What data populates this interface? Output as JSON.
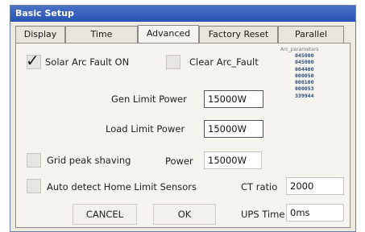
{
  "window": {
    "title": "Basic Setup"
  },
  "tabs": [
    "Display",
    "Time",
    "Advanced",
    "Factory Reset",
    "Parallel"
  ],
  "solar_arc_fault": {
    "label": "Solar Arc Fault ON",
    "checked": true
  },
  "clear_arc_fault": {
    "label": "Clear Arc_Fault"
  },
  "arc_log": {
    "header": "Arc_parameters",
    "values": [
      "045000",
      "045000",
      "004400",
      "000050",
      "000100",
      "000053",
      "339944"
    ]
  },
  "gen_limit_power": {
    "label": "Gen Limit Power",
    "value": "15000W"
  },
  "load_limit_power": {
    "label": "Load Limit Power",
    "value": "15000W"
  },
  "grid_peak_shaving": {
    "label": "Grid peak shaving",
    "power_label": "Power",
    "power_value": "15000W",
    "checked": false
  },
  "auto_detect": {
    "label": "Auto detect Home Limit Sensors",
    "checked": false
  },
  "ct_ratio": {
    "label": "CT ratio",
    "value": "2000"
  },
  "ups_time": {
    "label": "UPS Time",
    "value": "0ms"
  },
  "buttons": {
    "cancel": "CANCEL",
    "ok": "OK"
  }
}
